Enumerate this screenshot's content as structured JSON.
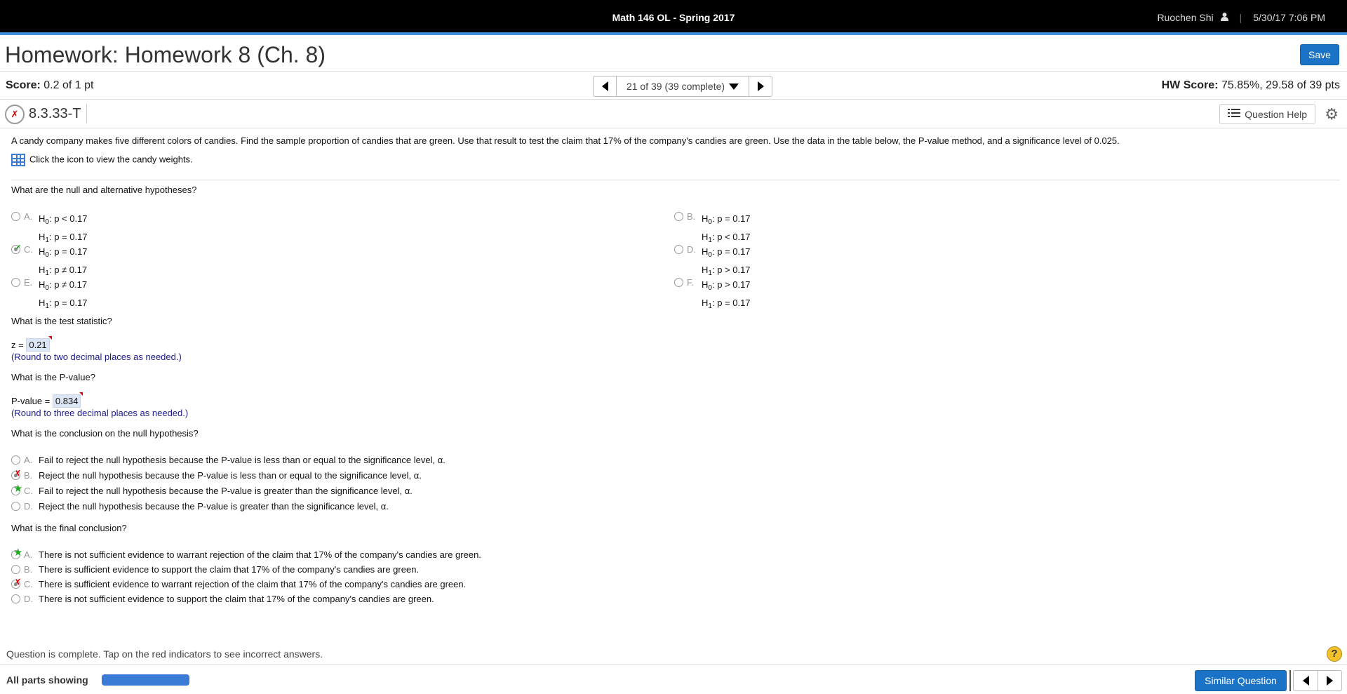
{
  "topbar": {
    "course": "Math 146 OL - Spring 2017",
    "user": "Ruochen Shi",
    "user_icon": "person-icon",
    "datetime": "5/30/17 7:06 PM"
  },
  "title": "Homework: Homework 8 (Ch. 8)",
  "save_label": "Save",
  "score": {
    "label": "Score:",
    "value": "0.2 of 1 pt"
  },
  "nav": {
    "position": "21 of 39 (39 complete)"
  },
  "hw_score": {
    "label": "HW Score:",
    "value": "75.85%, 29.58 of 39 pts"
  },
  "question": {
    "id": "8.3.33-T",
    "help_label": "Question Help"
  },
  "problem_text": "A candy company makes five different colors of candies. Find the sample proportion of candies that are green. Use that result to test the claim that 17% of the company's candies are green. Use the data in the table below, the P-value method, and a significance level of 0.025.",
  "data_link": "Click the icon to view the candy weights.",
  "q1": {
    "prompt": "What are the null and alternative hypotheses?",
    "options": [
      {
        "letter": "A.",
        "h0": "p < 0.17",
        "h1": "p = 0.17"
      },
      {
        "letter": "B.",
        "h0": "p = 0.17",
        "h1": "p < 0.17"
      },
      {
        "letter": "C.",
        "h0": "p = 0.17",
        "h1": "p ≠ 0.17"
      },
      {
        "letter": "D.",
        "h0": "p = 0.17",
        "h1": "p > 0.17"
      },
      {
        "letter": "E.",
        "h0": "p ≠ 0.17",
        "h1": "p = 0.17"
      },
      {
        "letter": "F.",
        "h0": "p > 0.17",
        "h1": "p = 0.17"
      }
    ],
    "h0_prefix": "H",
    "h0_sub": "0",
    "h1_prefix": "H",
    "h1_sub": "1"
  },
  "q2": {
    "prompt": "What is the test statistic?",
    "label": "z =",
    "answer": "0.21",
    "note": "(Round to two decimal places as needed.)"
  },
  "q3": {
    "prompt": "What is the P-value?",
    "label": "P-value =",
    "answer": "0.834",
    "note": "(Round to three decimal places as needed.)"
  },
  "q4": {
    "prompt": "What is the conclusion on the null hypothesis?",
    "options": [
      {
        "letter": "A.",
        "text": "Fail to reject the null hypothesis because the P-value is less than or equal to the significance level, α."
      },
      {
        "letter": "B.",
        "text": "Reject the null hypothesis because the P-value is less than or equal to the significance level, α."
      },
      {
        "letter": "C.",
        "text": "Fail to reject the null hypothesis because the P-value is greater than the significance level, α."
      },
      {
        "letter": "D.",
        "text": "Reject the null hypothesis because the P-value is greater than the significance level, α."
      }
    ]
  },
  "q5": {
    "prompt": "What is the final conclusion?",
    "options": [
      {
        "letter": "A.",
        "text": "There is not sufficient evidence to warrant rejection of the claim that 17% of the company's candies are green."
      },
      {
        "letter": "B.",
        "text": "There is sufficient evidence to support the claim that 17% of the company's candies are green."
      },
      {
        "letter": "C.",
        "text": "There is sufficient evidence to warrant rejection of the claim that 17% of the company's candies are green."
      },
      {
        "letter": "D.",
        "text": "There is not sufficient evidence to support the claim that 17% of the company's candies are green."
      }
    ]
  },
  "footer": {
    "message": "Question is complete. Tap on the red indicators to see incorrect answers.",
    "help": "?"
  },
  "bottom": {
    "parts_label": "All parts showing",
    "progress": 1.0,
    "similar_label": "Similar Question"
  },
  "colors": {
    "accent": "#3d8ed8",
    "button": "#1a73c7",
    "correct": "#2aa52a",
    "incorrect": "#d00000",
    "note": "#1a1a8c"
  }
}
